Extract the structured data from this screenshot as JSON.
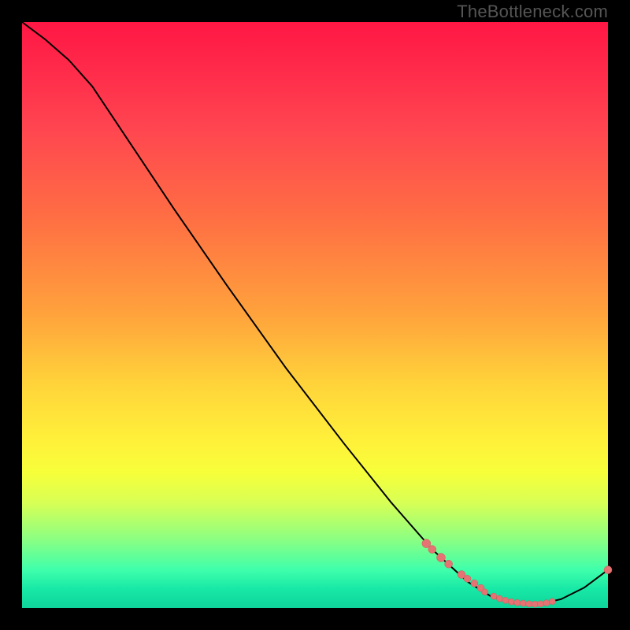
{
  "watermark": "TheBottleneck.com",
  "colors": {
    "curve_stroke": "#000000",
    "point_fill": "#e57373",
    "point_stroke": "#cc5a5a"
  },
  "chart_data": {
    "type": "line",
    "title": "",
    "xlabel": "",
    "ylabel": "",
    "xlim": [
      0,
      100
    ],
    "ylim": [
      0,
      100
    ],
    "curve": [
      {
        "x": 0,
        "y": 100
      },
      {
        "x": 4,
        "y": 97
      },
      {
        "x": 8,
        "y": 93.5
      },
      {
        "x": 12,
        "y": 89
      },
      {
        "x": 18,
        "y": 80
      },
      {
        "x": 26,
        "y": 68
      },
      {
        "x": 35,
        "y": 55
      },
      {
        "x": 45,
        "y": 41
      },
      {
        "x": 55,
        "y": 28
      },
      {
        "x": 63,
        "y": 18
      },
      {
        "x": 70,
        "y": 10
      },
      {
        "x": 76,
        "y": 4.5
      },
      {
        "x": 80,
        "y": 2
      },
      {
        "x": 84,
        "y": 0.8
      },
      {
        "x": 88,
        "y": 0.6
      },
      {
        "x": 92,
        "y": 1.5
      },
      {
        "x": 96,
        "y": 3.5
      },
      {
        "x": 100,
        "y": 6.5
      }
    ],
    "points": [
      {
        "x": 69,
        "y": 11,
        "r": 5.5
      },
      {
        "x": 70,
        "y": 10,
        "r": 5
      },
      {
        "x": 71.5,
        "y": 8.6,
        "r": 5.5
      },
      {
        "x": 72.8,
        "y": 7.5,
        "r": 5
      },
      {
        "x": 75,
        "y": 5.7,
        "r": 5
      },
      {
        "x": 76,
        "y": 5,
        "r": 4.5
      },
      {
        "x": 77.2,
        "y": 4.2,
        "r": 4.5
      },
      {
        "x": 78.3,
        "y": 3.4,
        "r": 4.5
      },
      {
        "x": 79,
        "y": 2.7,
        "r": 4
      },
      {
        "x": 80.5,
        "y": 2.0,
        "r": 4
      },
      {
        "x": 81.5,
        "y": 1.6,
        "r": 4
      },
      {
        "x": 82.5,
        "y": 1.3,
        "r": 4
      },
      {
        "x": 83.5,
        "y": 1.05,
        "r": 4
      },
      {
        "x": 84.5,
        "y": 0.9,
        "r": 4
      },
      {
        "x": 85.5,
        "y": 0.8,
        "r": 4
      },
      {
        "x": 86.5,
        "y": 0.7,
        "r": 4
      },
      {
        "x": 87.5,
        "y": 0.65,
        "r": 4
      },
      {
        "x": 88.5,
        "y": 0.7,
        "r": 4
      },
      {
        "x": 89.5,
        "y": 0.85,
        "r": 4
      },
      {
        "x": 90.5,
        "y": 1.1,
        "r": 4
      },
      {
        "x": 100,
        "y": 6.5,
        "r": 5
      }
    ]
  }
}
